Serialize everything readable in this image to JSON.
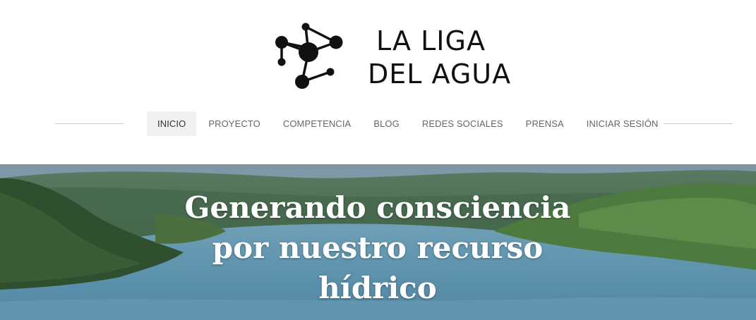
{
  "site": {
    "logo": {
      "line1": "LA LIGA",
      "line2": "DEL AGUA",
      "icon": "molecule-network-icon"
    }
  },
  "nav": {
    "items": [
      {
        "label": "INICIO",
        "active": true
      },
      {
        "label": "PROYECTO",
        "active": false
      },
      {
        "label": "COMPETENCIA",
        "active": false
      },
      {
        "label": "BLOG",
        "active": false
      },
      {
        "label": "REDES SOCIALES",
        "active": false
      },
      {
        "label": "PRENSA",
        "active": false
      },
      {
        "label": "INICIAR SESIÓN",
        "active": false
      }
    ]
  },
  "hero": {
    "heading": "Generando consciencia por nuestro recurso hídrico",
    "image": "lake-between-green-hills-photo"
  },
  "colors": {
    "text_dark": "#111111",
    "nav_text": "#666666",
    "nav_active_bg": "#f1f1f1",
    "rule": "#cccccc",
    "hero_text": "#ffffff"
  }
}
